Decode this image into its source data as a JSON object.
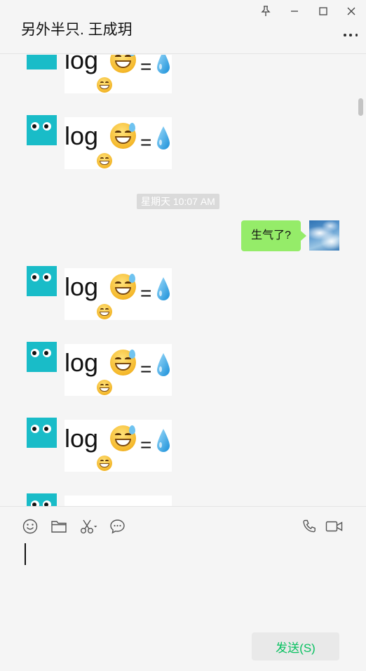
{
  "window": {
    "title": "另外半只. 王成玥"
  },
  "chat": {
    "sticker_text": {
      "base": "log",
      "equals": "="
    },
    "timestamp": "星期天 10:07 AM",
    "outgoing_message": "生气了?"
  },
  "composer": {
    "send_label": "发送(S)"
  },
  "icons": [
    "pin-icon",
    "minimize-icon",
    "maximize-icon",
    "close-icon",
    "more-icon",
    "emoji-icon",
    "folder-icon",
    "scissors-icon",
    "chat-history-icon",
    "phone-icon",
    "video-icon"
  ],
  "colors": {
    "bubble": "#95ec69",
    "avatar": "#19bcc8",
    "send_text": "#07c160"
  }
}
